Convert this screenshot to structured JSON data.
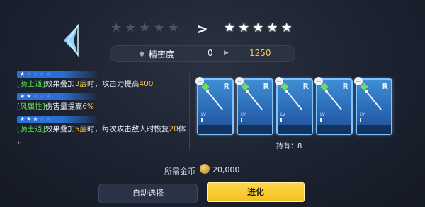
{
  "upgrade": {
    "current_stars": 0,
    "target_stars": 5,
    "max_stars": 5,
    "arrow": ">"
  },
  "precision": {
    "label": "精密度",
    "from": "0",
    "to": "1250"
  },
  "effects": [
    {
      "stars": 1,
      "parts": [
        {
          "text": "[骑士道]",
          "color": "green"
        },
        {
          "text": "效果叠加",
          "color": "white"
        },
        {
          "text": "3层",
          "color": "yellow"
        },
        {
          "text": "时，攻击力提高",
          "color": "white"
        },
        {
          "text": "400",
          "color": "yellow"
        }
      ]
    },
    {
      "stars": 2,
      "parts": [
        {
          "text": "[风属性]",
          "color": "green"
        },
        {
          "text": "伤害量提高",
          "color": "white"
        },
        {
          "text": "6%",
          "color": "yellow"
        }
      ]
    },
    {
      "stars": 3,
      "parts": [
        {
          "text": "[骑士道]",
          "color": "green"
        },
        {
          "text": "效果叠加",
          "color": "white"
        },
        {
          "text": "5层",
          "color": "yellow"
        },
        {
          "text": "时，每次攻击敌人时恢复",
          "color": "white"
        },
        {
          "text": "20",
          "color": "yellow"
        },
        {
          "text": "体",
          "color": "white"
        }
      ]
    }
  ],
  "effects_continuation": "↵",
  "materials": {
    "cards": [
      {
        "rank": "R",
        "lv": "LV"
      },
      {
        "rank": "R",
        "lv": "LV"
      },
      {
        "rank": "R",
        "lv": "LV"
      },
      {
        "rank": "R",
        "lv": "LV"
      },
      {
        "rank": "R",
        "lv": "LV"
      }
    ],
    "holding": "持有：8"
  },
  "cost": {
    "label": "所需金币",
    "value": "20,000"
  },
  "buttons": {
    "auto_select": "自动选择",
    "evolve": "进化"
  },
  "colors": {
    "accent": "#f2bf1f",
    "green": "#5ee04f",
    "yellow": "#f4c542",
    "card_blue": "#2a67b3"
  }
}
